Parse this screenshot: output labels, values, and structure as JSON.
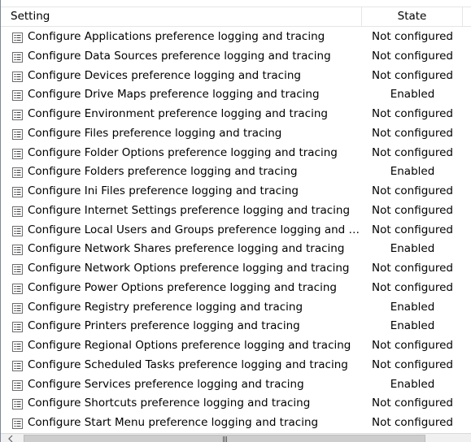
{
  "header": {
    "setting_label": "Setting",
    "state_label": "State"
  },
  "rows": [
    {
      "setting": "Configure Applications preference logging and tracing",
      "state": "Not configured"
    },
    {
      "setting": "Configure Data Sources preference logging and tracing",
      "state": "Not configured"
    },
    {
      "setting": "Configure Devices preference logging and tracing",
      "state": "Not configured"
    },
    {
      "setting": "Configure Drive Maps preference logging and tracing",
      "state": "Enabled"
    },
    {
      "setting": "Configure Environment preference logging and tracing",
      "state": "Not configured"
    },
    {
      "setting": "Configure Files preference logging and tracing",
      "state": "Not configured"
    },
    {
      "setting": "Configure Folder Options preference logging and tracing",
      "state": "Not configured"
    },
    {
      "setting": "Configure Folders preference logging and tracing",
      "state": "Enabled"
    },
    {
      "setting": "Configure Ini Files preference logging and tracing",
      "state": "Not configured"
    },
    {
      "setting": "Configure Internet Settings preference logging and tracing",
      "state": "Not configured"
    },
    {
      "setting": "Configure Local Users and Groups preference logging and tr...",
      "state": "Not configured"
    },
    {
      "setting": "Configure Network Shares preference logging and tracing",
      "state": "Enabled"
    },
    {
      "setting": "Configure Network Options preference logging and tracing",
      "state": "Not configured"
    },
    {
      "setting": "Configure Power Options preference logging and tracing",
      "state": "Not configured"
    },
    {
      "setting": "Configure Registry preference logging and tracing",
      "state": "Enabled"
    },
    {
      "setting": "Configure Printers preference logging and tracing",
      "state": "Enabled"
    },
    {
      "setting": "Configure Regional Options preference logging and tracing",
      "state": "Not configured"
    },
    {
      "setting": "Configure Scheduled Tasks preference logging and tracing",
      "state": "Not configured"
    },
    {
      "setting": "Configure Services preference logging and tracing",
      "state": "Enabled"
    },
    {
      "setting": "Configure Shortcuts preference logging and tracing",
      "state": "Not configured"
    },
    {
      "setting": "Configure Start Menu preference logging and tracing",
      "state": "Not configured"
    }
  ],
  "icons": {
    "row_icon": "policy-setting-icon",
    "scroll_left": "chevron-left-icon",
    "thumb_grip": "scroll-grip-icon"
  },
  "colors": {
    "border": "#828790",
    "header_divider": "#e5e5e5",
    "scrollbar_track": "#f0f0f0",
    "scrollbar_thumb": "#cdcdcd"
  }
}
